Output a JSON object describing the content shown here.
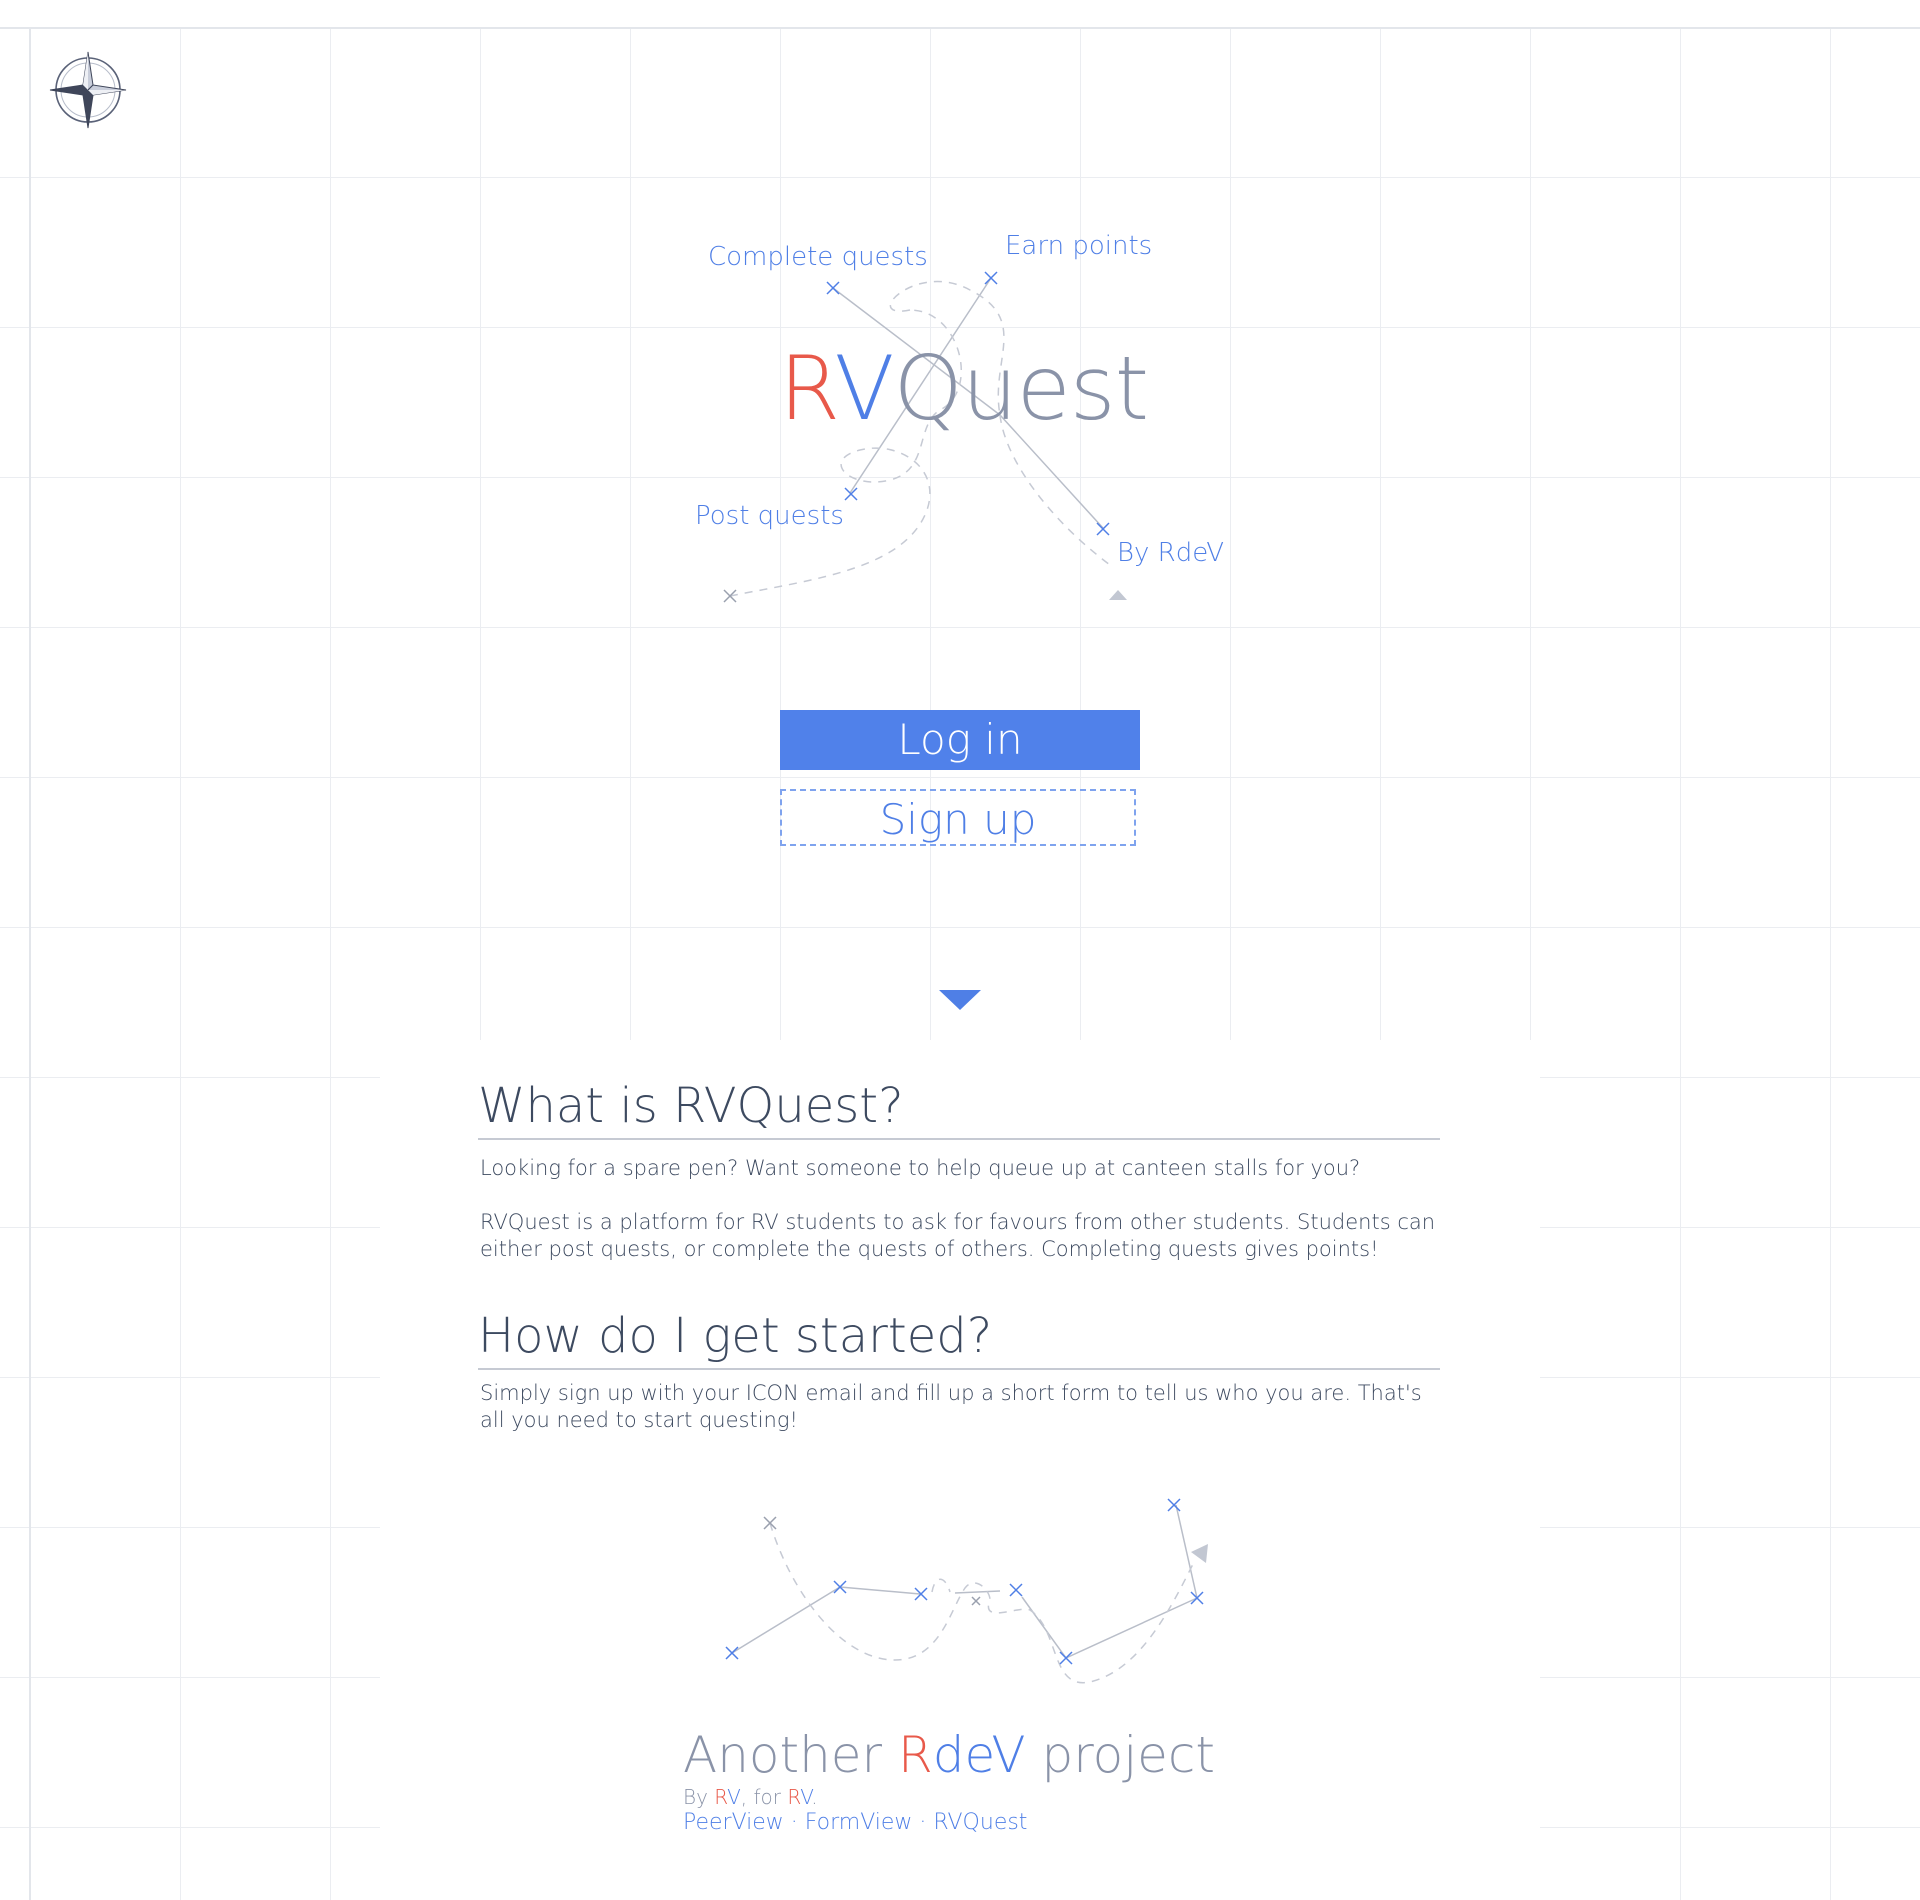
{
  "hero": {
    "labels": {
      "complete": "Complete quests",
      "earn": "Earn points",
      "post": "Post quests",
      "by": "By RdeV"
    },
    "logo": {
      "r": "R",
      "v": "V",
      "rest": "Quest"
    }
  },
  "auth": {
    "login_label": "Log in",
    "signup_label": "Sign up"
  },
  "about": {
    "title": "What is RVQuest?",
    "p1": "Looking for a spare pen? Want someone to help queue up at canteen stalls for you?",
    "p2": "RVQuest is a platform for RV students to ask for favours from other students. Students can either post quests, or complete the quests of others. Completing quests gives points!"
  },
  "start": {
    "title": "How do I get started?",
    "p1": "Simply sign up with your ICON email and fill up a short form to tell us who you are. That's all you need to start questing!"
  },
  "footer": {
    "another": "Another ",
    "r": "R",
    "dev": "deV",
    "project": " project",
    "by_prefix": "By ",
    "by_r": "R",
    "by_v": "V",
    "for_prefix": ", for ",
    "for_r": "R",
    "for_v": "V",
    "for_suffix": ".",
    "links": [
      "PeerView",
      "FormView",
      "RVQuest"
    ],
    "separator": " · "
  },
  "icons": {
    "compass": "compass-icon",
    "scroll": "chevron-down-icon"
  },
  "colors": {
    "accent_blue": "#4f7fe6",
    "accent_red": "#e8594a",
    "muted_gray": "#8a93a8",
    "text": "#3d4a60"
  }
}
